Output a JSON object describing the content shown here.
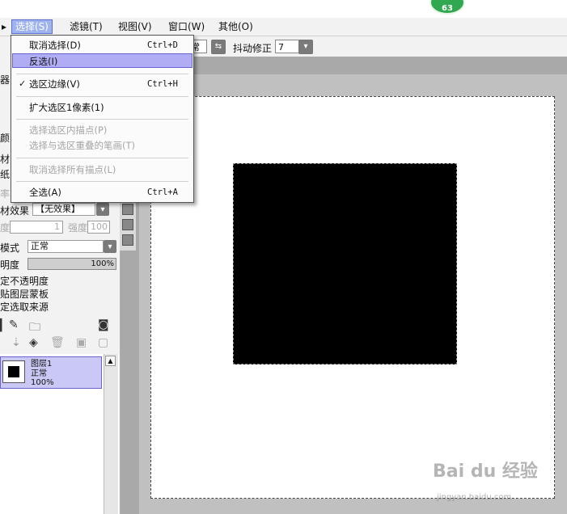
{
  "badge": {
    "count": "63"
  },
  "menubar": {
    "items": [
      "选择(S)",
      "滤镜(T)",
      "视图(V)",
      "窗口(W)",
      "其他(O)"
    ],
    "left_stub": "▸"
  },
  "toolbar": {
    "mode_fragment": "常",
    "stabilizer_label": "抖动修正",
    "stabilizer_value": "7"
  },
  "dropdown": {
    "items": [
      {
        "label": "取消选择(D)",
        "shortcut": "Ctrl+D"
      },
      {
        "label": "反选(I)",
        "shortcut": ""
      },
      {
        "label": "选区边缘(V)",
        "shortcut": "Ctrl+H",
        "checked": "✓"
      },
      {
        "label": "扩大选区1像素(1)",
        "shortcut": ""
      },
      {
        "label": "选择选区内描点(P)",
        "shortcut": ""
      },
      {
        "label": "选择与选区重叠的笔画(T)",
        "shortcut": ""
      },
      {
        "label": "取消选择所有描点(L)",
        "shortcut": ""
      },
      {
        "label": "全选(A)",
        "shortcut": "Ctrl+A"
      }
    ]
  },
  "leftpanel": {
    "frag_qi": "器",
    "frag_e": "颜",
    "frag_cai1": "材",
    "frag_zhi": "纸",
    "frag_lv": "率",
    "texture_label": "材效果",
    "texture_value": "【无效果】",
    "degree_label": "度",
    "degree_value": "1",
    "strength_label": "强度",
    "strength_value": "100",
    "blend_label": "模式",
    "blend_value": "正常",
    "opacity_label": "明度",
    "opacity_value": "100%",
    "opt1": "定不透明度",
    "opt2": "贴图层蒙板",
    "opt3": "定选取来源"
  },
  "layer": {
    "name": "图层1",
    "mode": "正常",
    "opacity": "100%"
  },
  "watermark": {
    "text": "Bai du 经验",
    "url": "jingyan.baidu.com"
  }
}
